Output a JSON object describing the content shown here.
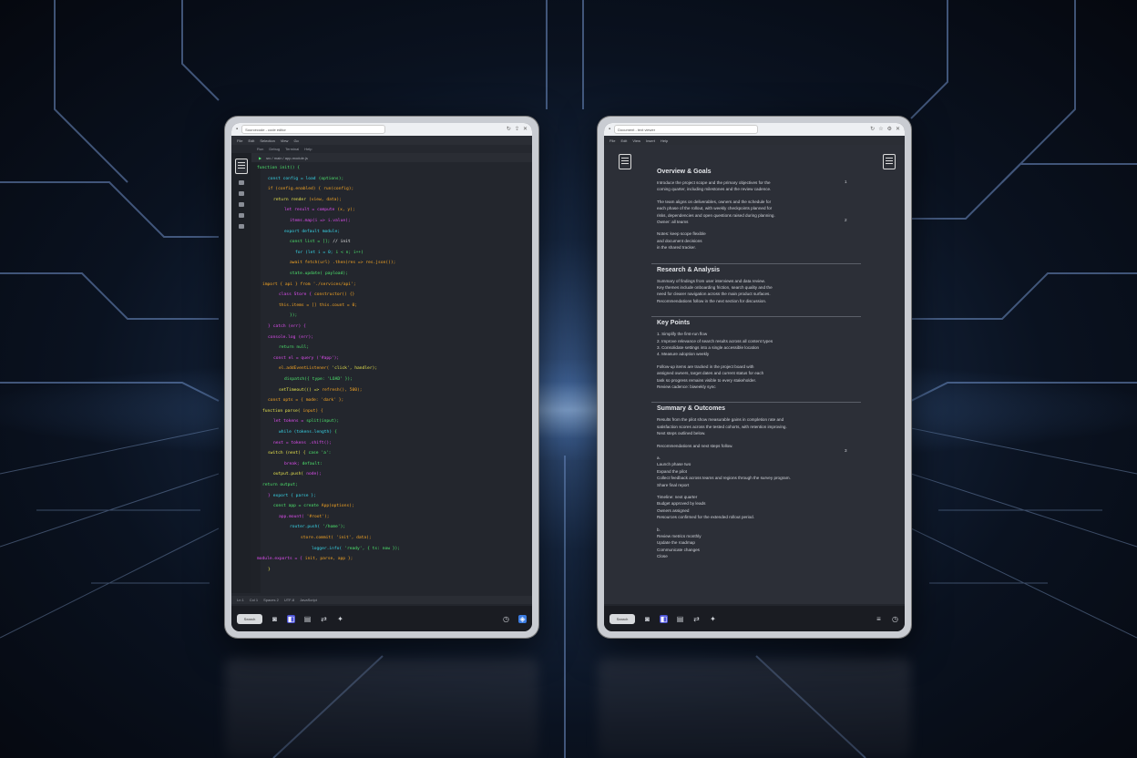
{
  "background": {
    "theme": "circuit-board",
    "accent": "#8fb6ff"
  },
  "left_tablet": {
    "browser": {
      "tab_title": "Sourcecode - code editor",
      "url": "code-editor",
      "icon_right": "close-icon"
    },
    "menu": [
      "File",
      "Edit",
      "Selection",
      "View",
      "Go"
    ],
    "toolbar": [
      "Run",
      "Debug",
      "Terminal",
      "Help"
    ],
    "tab_path": "src / main / app-module.js",
    "status": [
      "Ln 1",
      "Col 1",
      "Spaces 2",
      "UTF-8",
      "JavaScript"
    ],
    "dock": {
      "search": "Search"
    },
    "colors": {
      "green": "#4ee86e",
      "orange": "#f5a524",
      "magenta": "#e04ef0",
      "cyan": "#38d6e8",
      "yellow": "#e8e44e",
      "white": "#e6e6e6"
    },
    "code_lines": [
      {
        "indent": 0,
        "tokens": [
          {
            "t": "function init() {",
            "c": "green"
          }
        ]
      },
      {
        "indent": 2,
        "tokens": [
          {
            "t": "const config = load",
            "c": "cyan"
          },
          {
            "t": "(options);",
            "c": "green"
          }
        ]
      },
      {
        "indent": 2,
        "tokens": [
          {
            "t": "if (config.enabled) {",
            "c": "orange"
          },
          {
            "t": "run(config);",
            "c": "orange"
          }
        ]
      },
      {
        "indent": 3,
        "tokens": [
          {
            "t": "return render",
            "c": "yellow"
          },
          {
            "t": "(view, data);",
            "c": "orange"
          }
        ]
      },
      {
        "indent": 5,
        "tokens": [
          {
            "t": "let result = compute",
            "c": "magenta"
          },
          {
            "t": "(x, y);",
            "c": "orange"
          }
        ]
      },
      {
        "indent": 6,
        "tokens": [
          {
            "t": "items.map(i =>",
            "c": "magenta"
          },
          {
            "t": "i.value);",
            "c": "magenta"
          }
        ]
      },
      {
        "indent": 5,
        "tokens": [
          {
            "t": "export default",
            "c": "cyan"
          },
          {
            "t": "module;",
            "c": "cyan"
          }
        ]
      },
      {
        "indent": 6,
        "tokens": [
          {
            "t": "const list = [];",
            "c": "green"
          },
          {
            "t": "// init",
            "c": "white"
          }
        ]
      },
      {
        "indent": 7,
        "tokens": [
          {
            "t": "for (let i = 0;",
            "c": "cyan"
          },
          {
            "t": "i < n; i++)",
            "c": "green"
          }
        ]
      },
      {
        "indent": 6,
        "tokens": [
          {
            "t": "await fetch(url)",
            "c": "orange"
          },
          {
            "t": ".then(res => res.json());",
            "c": "orange"
          }
        ]
      },
      {
        "indent": 6,
        "tokens": [
          {
            "t": "state.update(",
            "c": "green"
          },
          {
            "t": "payload);",
            "c": "green"
          }
        ]
      },
      {
        "indent": 1,
        "tokens": [
          {
            "t": "import { api } from",
            "c": "orange"
          },
          {
            "t": "'./services/api';",
            "c": "orange"
          }
        ]
      },
      {
        "indent": 4,
        "tokens": [
          {
            "t": "class Store {",
            "c": "magenta"
          },
          {
            "t": "constructor() {}",
            "c": "orange"
          }
        ]
      },
      {
        "indent": 4,
        "tokens": [
          {
            "t": "this.items = []",
            "c": "orange"
          },
          {
            "t": "this.count = 0;",
            "c": "orange"
          }
        ]
      },
      {
        "indent": 6,
        "tokens": [
          {
            "t": "});",
            "c": "green"
          }
        ]
      },
      {
        "indent": 2,
        "tokens": [
          {
            "t": "}",
            "c": "magenta"
          },
          {
            "t": "catch (err) {",
            "c": "magenta"
          }
        ]
      },
      {
        "indent": 2,
        "tokens": [
          {
            "t": "console.log",
            "c": "magenta"
          },
          {
            "t": "(err);",
            "c": "magenta"
          }
        ]
      },
      {
        "indent": 4,
        "tokens": [
          {
            "t": "return null;",
            "c": "green"
          }
        ]
      },
      {
        "indent": 3,
        "tokens": [
          {
            "t": "const el = query",
            "c": "magenta"
          },
          {
            "t": "('#app');",
            "c": "magenta"
          }
        ]
      },
      {
        "indent": 4,
        "tokens": [
          {
            "t": "el.addEventListener(",
            "c": "orange"
          },
          {
            "t": "'click', handler);",
            "c": "yellow"
          }
        ]
      },
      {
        "indent": 5,
        "tokens": [
          {
            "t": "dispatch({",
            "c": "green"
          },
          {
            "t": "type: 'LOAD' });",
            "c": "green"
          }
        ]
      },
      {
        "indent": 4,
        "tokens": [
          {
            "t": "setTimeout(() =>",
            "c": "yellow"
          },
          {
            "t": "refresh(), 500);",
            "c": "orange"
          }
        ]
      },
      {
        "indent": 2,
        "tokens": [
          {
            "t": "const opts = {",
            "c": "orange"
          },
          {
            "t": "mode: 'dark' };",
            "c": "orange"
          }
        ]
      },
      {
        "indent": 1,
        "tokens": [
          {
            "t": "function parse(",
            "c": "yellow"
          },
          {
            "t": "input) {",
            "c": "orange"
          }
        ]
      },
      {
        "indent": 3,
        "tokens": [
          {
            "t": "let tokens =",
            "c": "magenta"
          },
          {
            "t": "split(input);",
            "c": "green"
          }
        ]
      },
      {
        "indent": 4,
        "tokens": [
          {
            "t": "while (tokens.length)",
            "c": "cyan"
          },
          {
            "t": "{",
            "c": "green"
          }
        ]
      },
      {
        "indent": 3,
        "tokens": [
          {
            "t": "next = tokens",
            "c": "magenta"
          },
          {
            "t": ".shift();",
            "c": "magenta"
          }
        ]
      },
      {
        "indent": 2,
        "tokens": [
          {
            "t": "switch (next) {",
            "c": "yellow"
          },
          {
            "t": "case 'a':",
            "c": "green"
          }
        ]
      },
      {
        "indent": 5,
        "tokens": [
          {
            "t": "break;",
            "c": "magenta"
          },
          {
            "t": "default:",
            "c": "green"
          }
        ]
      },
      {
        "indent": 3,
        "tokens": [
          {
            "t": "output.push(",
            "c": "yellow"
          },
          {
            "t": "node);",
            "c": "magenta"
          }
        ]
      },
      {
        "indent": 1,
        "tokens": [
          {
            "t": "return output;",
            "c": "green"
          }
        ]
      },
      {
        "indent": 2,
        "tokens": [
          {
            "t": "}",
            "c": "magenta"
          },
          {
            "t": "export { parse };",
            "c": "cyan"
          }
        ]
      },
      {
        "indent": 3,
        "tokens": [
          {
            "t": "const app = create",
            "c": "green"
          },
          {
            "t": "App(options);",
            "c": "orange"
          }
        ]
      },
      {
        "indent": 4,
        "tokens": [
          {
            "t": "app.mount(",
            "c": "magenta"
          },
          {
            "t": "'#root');",
            "c": "orange"
          }
        ]
      },
      {
        "indent": 6,
        "tokens": [
          {
            "t": "router.push(",
            "c": "cyan"
          },
          {
            "t": "'/home');",
            "c": "green"
          }
        ]
      },
      {
        "indent": 8,
        "tokens": [
          {
            "t": "store.commit(",
            "c": "orange"
          },
          {
            "t": "'init', data);",
            "c": "orange"
          }
        ]
      },
      {
        "indent": 10,
        "tokens": [
          {
            "t": "logger.info(",
            "c": "cyan"
          },
          {
            "t": "'ready', { ts: now });",
            "c": "green"
          }
        ]
      },
      {
        "indent": 0,
        "tokens": [
          {
            "t": "module.exports = {",
            "c": "magenta"
          },
          {
            "t": "init, parse, app };",
            "c": "orange"
          }
        ]
      },
      {
        "indent": 2,
        "tokens": [
          {
            "t": "}",
            "c": "yellow"
          }
        ]
      }
    ]
  },
  "right_tablet": {
    "browser": {
      "tab_title": "Document - text viewer",
      "url": "document-viewer"
    },
    "menu": [
      "File",
      "Edit",
      "View",
      "Insert",
      "Help"
    ],
    "dock": {
      "search": "Search"
    },
    "sections": [
      {
        "heading": "Overview & Goals",
        "paras": [
          [
            "Introduce the project scope and the primary objectives for the",
            "coming quarter, including milestones and the review cadence."
          ],
          [
            "The team aligns on deliverables, owners and the schedule for",
            "each phase of the rollout, with weekly checkpoints planned for",
            "risks, dependencies and open questions raised during planning.",
            "Owner: all teams"
          ],
          [
            "Notes: keep scope flexible",
            "and document decisions",
            "in the shared tracker."
          ]
        ]
      },
      {
        "heading": "Research & Analysis",
        "paras": [
          [
            "Summary of findings from user interviews and data review.",
            "Key themes include onboarding friction, search quality and the",
            "need for clearer navigation across the main product surfaces.",
            "Recommendations follow in the next section for discussion."
          ]
        ]
      },
      {
        "heading": "Key Points",
        "paras": [
          [
            "1. Simplify the first-run flow",
            "2. Improve relevance of search results across all content types",
            "3. Consolidate settings into a single accessible location",
            "4. Measure adoption weekly"
          ],
          [
            "Follow-up items are tracked in the project board with",
            "assigned owners, target dates and current status for each",
            "task so progress remains visible to every stakeholder.",
            "Review cadence: biweekly sync"
          ]
        ]
      },
      {
        "heading": "Summary & Outcomes",
        "paras": [
          [
            "Results from the pilot show measurable gains in completion rate and",
            "satisfaction scores across the tested cohorts, with retention improving.",
            "Next steps outlined below."
          ],
          [
            "Recommendations and next steps follow."
          ],
          [
            "a.",
            "Launch phase two",
            "Expand the pilot",
            "Collect feedback across teams and regions through the survey program.",
            "Share final report"
          ],
          [
            "Timeline: next quarter",
            "Budget approved by leads",
            "Owners assigned",
            "Resources confirmed for the extended rollout period."
          ],
          [
            "b.",
            "Review metrics monthly",
            "Update the roadmap",
            "Communicate changes",
            "Close"
          ]
        ]
      }
    ],
    "page_numbers": [
      "1",
      "2",
      "3"
    ]
  }
}
